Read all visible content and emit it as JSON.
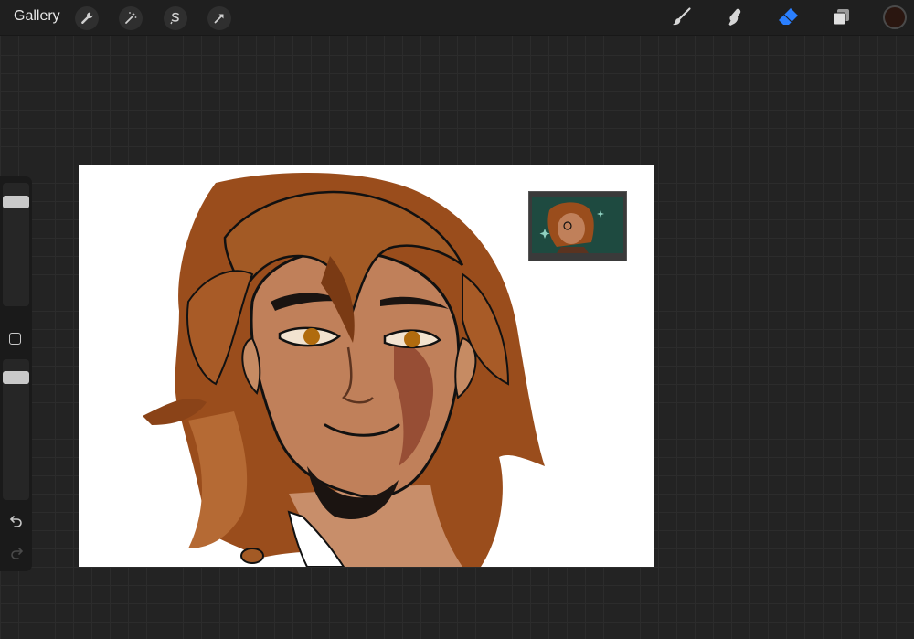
{
  "topbar": {
    "gallery_label": "Gallery",
    "left_tools": [
      "wrench-icon",
      "magic-wand-icon",
      "selection-icon",
      "transform-arrow-icon"
    ],
    "right_tools": [
      "brush-icon",
      "smudge-icon",
      "eraser-icon",
      "layers-icon"
    ],
    "active_tool": "eraser-icon",
    "active_color": "#2a1610"
  },
  "sidebar": {
    "size_slider": 0.95,
    "opacity_slider": 0.95,
    "buttons": [
      "modify-square-icon",
      "undo-icon",
      "redo-icon"
    ]
  },
  "canvas": {
    "subject": "",
    "reference_window": ""
  },
  "colors": {
    "accent": "#2a7fff",
    "hair": "#a1501d",
    "skin": "#b9764d",
    "bg": "#232323"
  }
}
